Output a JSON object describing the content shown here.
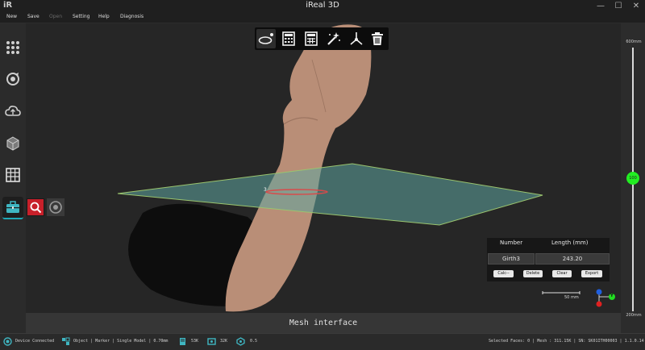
{
  "app": {
    "title": "iReal 3D",
    "logo_text": "iR"
  },
  "window_controls": {
    "minimize": "—",
    "maximize": "☐",
    "close": "✕"
  },
  "menu": [
    {
      "label": "New",
      "enabled": true
    },
    {
      "label": "Save",
      "enabled": true
    },
    {
      "label": "Open",
      "enabled": false
    },
    {
      "label": "Setting",
      "enabled": true
    },
    {
      "label": "Help",
      "enabled": true
    },
    {
      "label": "Diagnosis",
      "enabled": true
    }
  ],
  "sidebar": {
    "items": [
      {
        "icon": "grid-dots-icon",
        "active": false
      },
      {
        "icon": "scan-icon",
        "active": false
      },
      {
        "icon": "cloud-icon",
        "active": false
      },
      {
        "icon": "mesh-cube-icon",
        "active": false
      },
      {
        "icon": "calendar-grid-icon",
        "active": false
      },
      {
        "icon": "toolbox-icon",
        "active": true
      }
    ]
  },
  "subtools": [
    {
      "icon": "magnify-icon",
      "active": true
    },
    {
      "icon": "orbit-icon",
      "active": false
    }
  ],
  "toolbar": {
    "tools": [
      {
        "icon": "girth-loop-icon",
        "active": true
      },
      {
        "icon": "calculator-icon",
        "active": false
      },
      {
        "icon": "calculator-grid-icon",
        "active": false
      },
      {
        "icon": "magic-wand-icon",
        "active": false
      },
      {
        "icon": "axis-tripod-icon",
        "active": false
      },
      {
        "icon": "trash-icon",
        "active": false
      }
    ]
  },
  "viewport": {
    "plane_color": "#5fa6a0",
    "girth_marker_label": "3",
    "scale_bar_label": "50 mm"
  },
  "measurement": {
    "columns": [
      "Number",
      "Length (mm)"
    ],
    "rows": [
      {
        "number": "Girth3",
        "length": "243.20"
      }
    ],
    "buttons": [
      "Calc--",
      "Delete",
      "Clear",
      "Export"
    ]
  },
  "axis_gizmo": {
    "x_color": "#e02020",
    "y_color": "#22dd22",
    "z_color": "#2060e0",
    "y_label": "Y"
  },
  "slider": {
    "top_label": "600mm",
    "bottom_label": "200mm",
    "knob_label": "100",
    "knob_color": "#22ee22"
  },
  "mesh_bar": {
    "label": "Mesh interface"
  },
  "status": {
    "device": "Device Connected",
    "mode": "Object | Marker | Single Model | 0.70mm",
    "stat1": "53K",
    "stat2": "32K",
    "stat3": "0.5",
    "right": "Selected Faces: 0 | Mesh : 311.15K | SN: SK01ITH00003 | 1.1.0.14"
  }
}
